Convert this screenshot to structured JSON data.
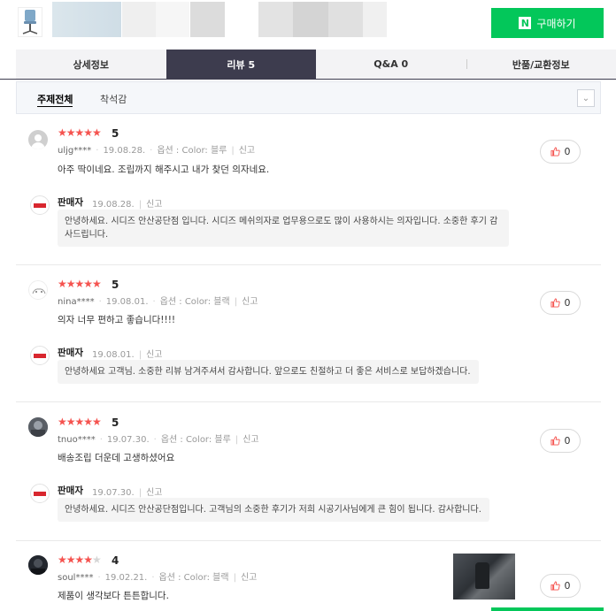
{
  "header": {
    "product_thumb_icon": "office-chair-icon",
    "buy_button": {
      "logo": "N",
      "label": "구매하기"
    }
  },
  "tabs": [
    {
      "label": "상세정보",
      "active": false
    },
    {
      "label": "리뷰 5",
      "active": true
    },
    {
      "label": "Q&A 0",
      "active": false
    },
    {
      "label": "반품/교환정보",
      "active": false
    }
  ],
  "filter": {
    "items": [
      "주제전체",
      "착석감"
    ],
    "toggle_icon": "chevron-down-icon"
  },
  "reviews": [
    {
      "rating": 5,
      "score": "5",
      "user": "uljg****",
      "date": "19.08.28.",
      "option": "옵션 : Color: 블루",
      "report": "신고",
      "text": "아주 딱이네요. 조립까지 해주시고 내가 찾던 의자네요.",
      "likes": "0",
      "reply": {
        "name": "판매자",
        "date": "19.08.28.",
        "report": "신고",
        "lines": [
          "안녕하세요. 시디즈 안산공단점 입니다. 시디즈 메쉬의자로 업무용으로도 많이 사용하시는 의자입니다. 소중한 후기 감",
          "사드립니다."
        ]
      }
    },
    {
      "rating": 5,
      "score": "5",
      "user": "nina****",
      "date": "19.08.01.",
      "option": "옵션 : Color: 블랙",
      "report": "신고",
      "text": "의자 너무 편하고 좋습니다!!!!",
      "likes": "0",
      "reply": {
        "name": "판매자",
        "date": "19.08.01.",
        "report": "신고",
        "lines": [
          "안녕하세요 고객님. 소중한 리뷰 남겨주셔서 감사합니다. 앞으로도 친절하고 더 좋은 서비스로 보답하겠습니다."
        ]
      }
    },
    {
      "rating": 5,
      "score": "5",
      "user": "tnuo****",
      "date": "19.07.30.",
      "option": "옵션 : Color: 블루",
      "report": "신고",
      "text": "배송조립 더운데 고생하셨어요",
      "likes": "0",
      "reply": {
        "name": "판매자",
        "date": "19.07.30.",
        "report": "신고",
        "lines": [
          "안녕하세요. 시디즈 안산공단점입니다. 고객님의 소중한 후기가 저희 시공기사님에게 큰 힘이 됩니다. 감사합니다."
        ]
      }
    },
    {
      "rating": 4,
      "score": "4",
      "user": "soul****",
      "date": "19.02.21.",
      "option": "옵션 : Color: 블랙",
      "report": "신고",
      "text": "제품이 생각보다 튼튼합니다.",
      "likes": "0"
    }
  ],
  "colors": {
    "accent_green": "#03c75a",
    "active_tab": "#3d3c4e",
    "star": "#f5534f"
  }
}
